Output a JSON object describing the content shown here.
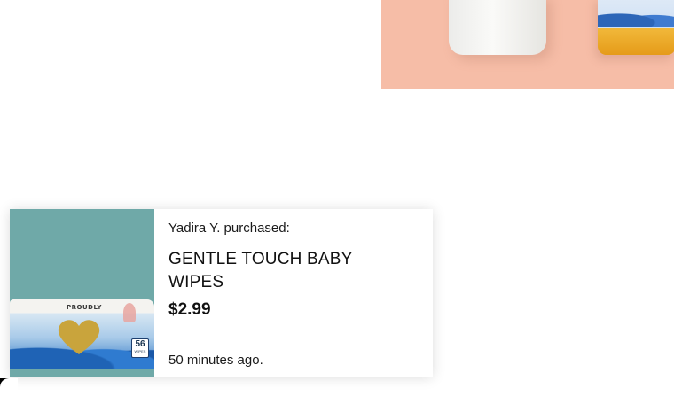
{
  "notification": {
    "buyer_line": "Yadira Y. purchased:",
    "product_name": "GENTLE TOUCH BABY WIPES",
    "price": "$2.99",
    "time_ago": "50 minutes ago.",
    "image": {
      "brand": "PROUDLY",
      "count": "56",
      "count_unit": "WIPES"
    }
  },
  "hero": {
    "image": "baby-products-photo"
  },
  "colors": {
    "hero_background": "#f6bda7",
    "popup_image_background": "#6fa9a8",
    "text": "#111111"
  }
}
